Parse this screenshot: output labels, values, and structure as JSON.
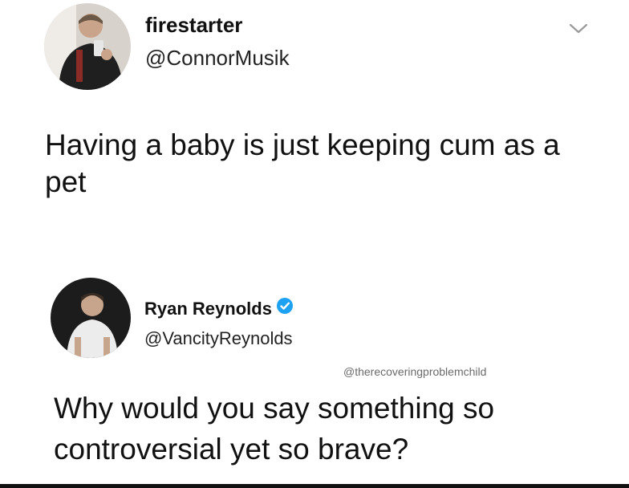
{
  "tweet1": {
    "display_name": "firestarter",
    "handle": "@ConnorMusik",
    "text": "Having a baby is just keeping cum as a pet",
    "avatar_icon": "user-photo",
    "menu_icon": "chevron-down-icon"
  },
  "tweet2": {
    "display_name": "Ryan Reynolds",
    "handle": "@VancityReynolds",
    "verified": true,
    "verified_icon": "verified-badge-icon",
    "avatar_icon": "user-photo",
    "watermark": "@therecoveringproblemchild",
    "text": "Why would you say something so controversial yet so brave?"
  },
  "colors": {
    "verified_blue": "#1da1f2",
    "text": "#111111",
    "watermark": "#6a6a6a"
  }
}
